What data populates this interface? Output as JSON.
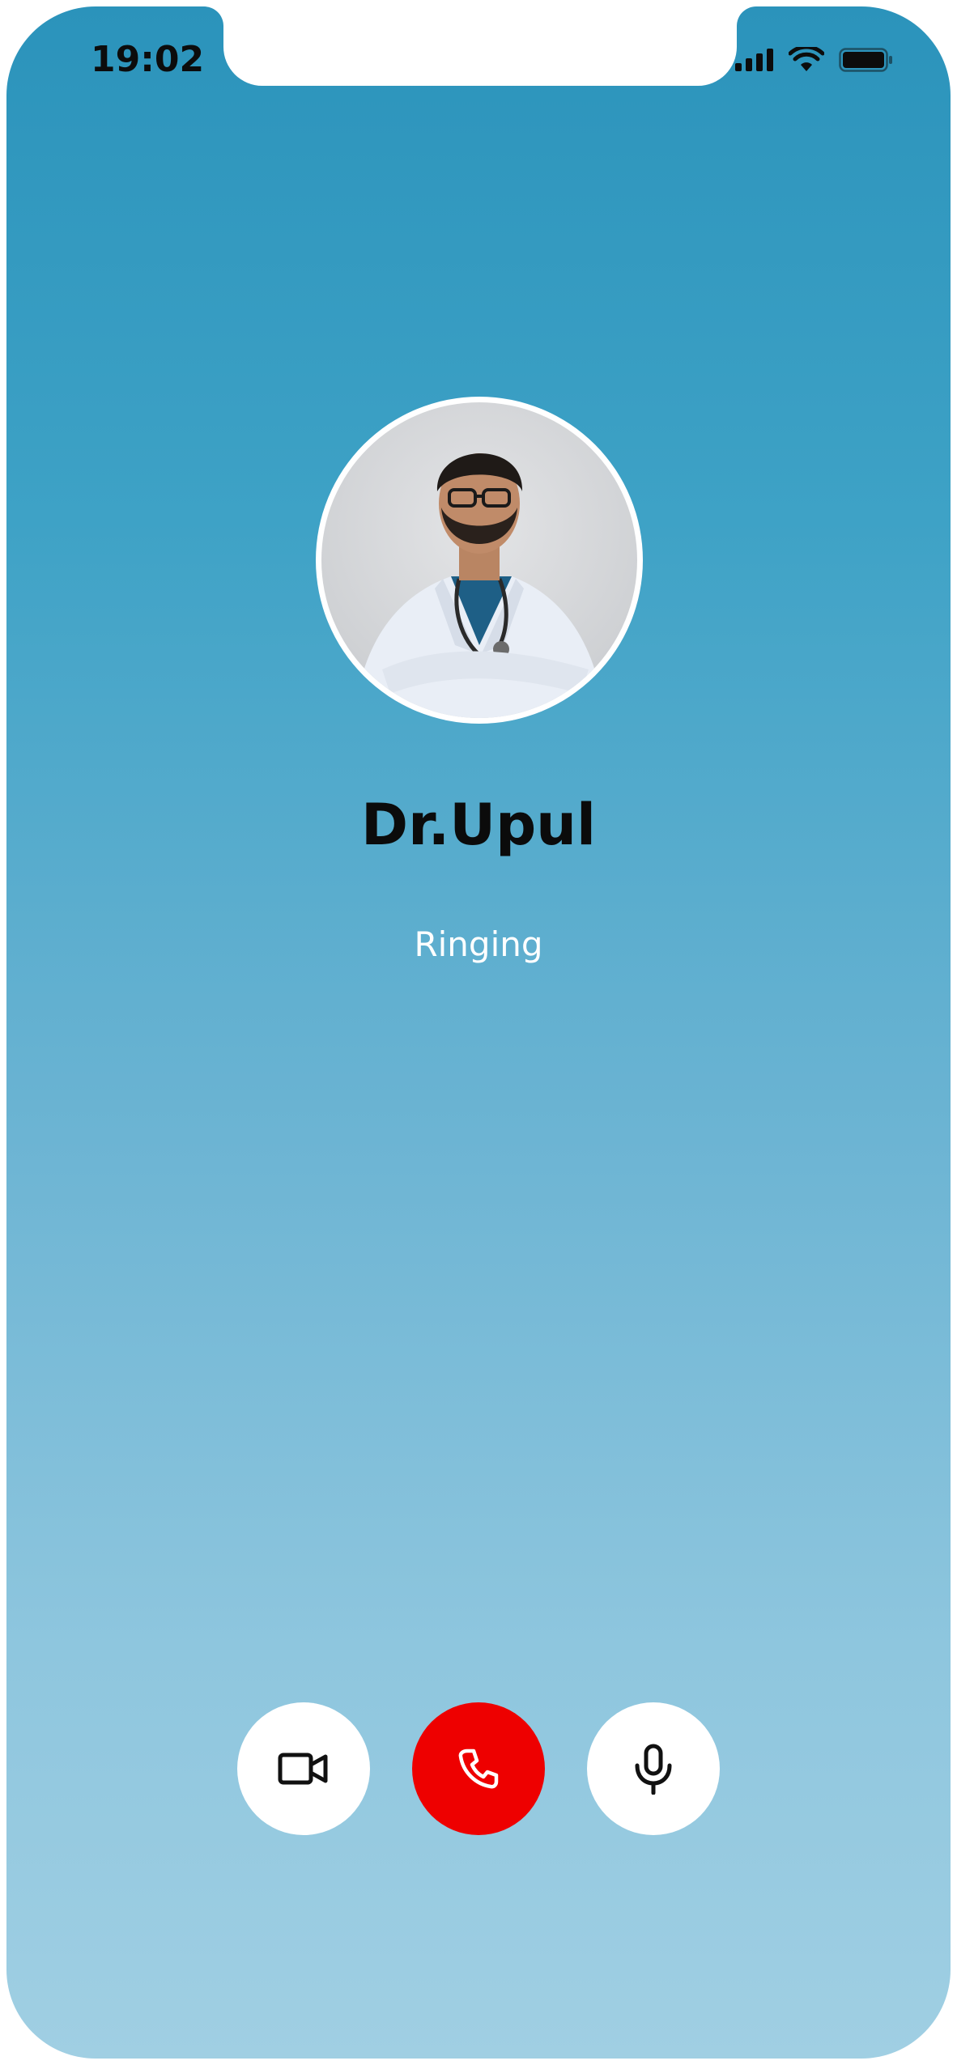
{
  "status_bar": {
    "time": "19:02",
    "icons": [
      "signal-icon",
      "wifi-icon",
      "battery-icon"
    ]
  },
  "call": {
    "caller_name": "Dr.Upul",
    "status": "Ringing",
    "avatar": "doctor-avatar"
  },
  "controls": [
    {
      "name": "video-button",
      "icon": "video-camera-icon"
    },
    {
      "name": "end-call-button",
      "icon": "phone-icon",
      "color": "#ee0000"
    },
    {
      "name": "mute-button",
      "icon": "microphone-icon"
    }
  ],
  "colors": {
    "background_top": "#2b93bb",
    "background_bottom": "#a0cfe3",
    "end_call": "#ee0000"
  }
}
